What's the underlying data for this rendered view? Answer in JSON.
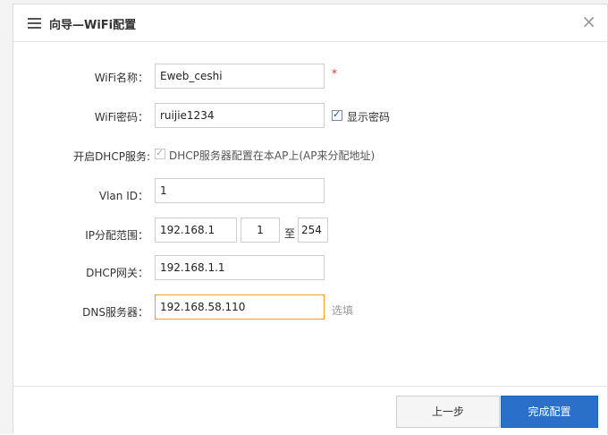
{
  "dialog": {
    "title": "向导—WiFi配置",
    "close_glyph": "×"
  },
  "form": {
    "wifi_name": {
      "label": "WiFi名称：",
      "value": "Eweb_ceshi",
      "required_mark": "*"
    },
    "wifi_password": {
      "label": "WiFi密码：",
      "value": "ruijie1234",
      "show_password_label": "显示密码",
      "show_password_checked": true
    },
    "dhcp_service": {
      "label": "开启DHCP服务:",
      "option_label": "DHCP服务器配置在本AP上(AP来分配地址)",
      "checked": true
    },
    "vlan_id": {
      "label": "Vlan ID：",
      "value": "1"
    },
    "ip_range": {
      "label": "IP分配范围：",
      "prefix": "192.168.1",
      "start": "1",
      "separator": "至",
      "end": "254"
    },
    "dhcp_gateway": {
      "label": "DHCP网关：",
      "value": "192.168.1.1"
    },
    "dns_server": {
      "label": "DNS服务器：",
      "value": "192.168.58.110",
      "hint": "选填"
    }
  },
  "footer": {
    "prev_label": "上一步",
    "finish_label": "完成配置"
  },
  "colors": {
    "primary": "#2a6fc9",
    "required": "#e0332c",
    "focus_border": "#f0a030"
  }
}
